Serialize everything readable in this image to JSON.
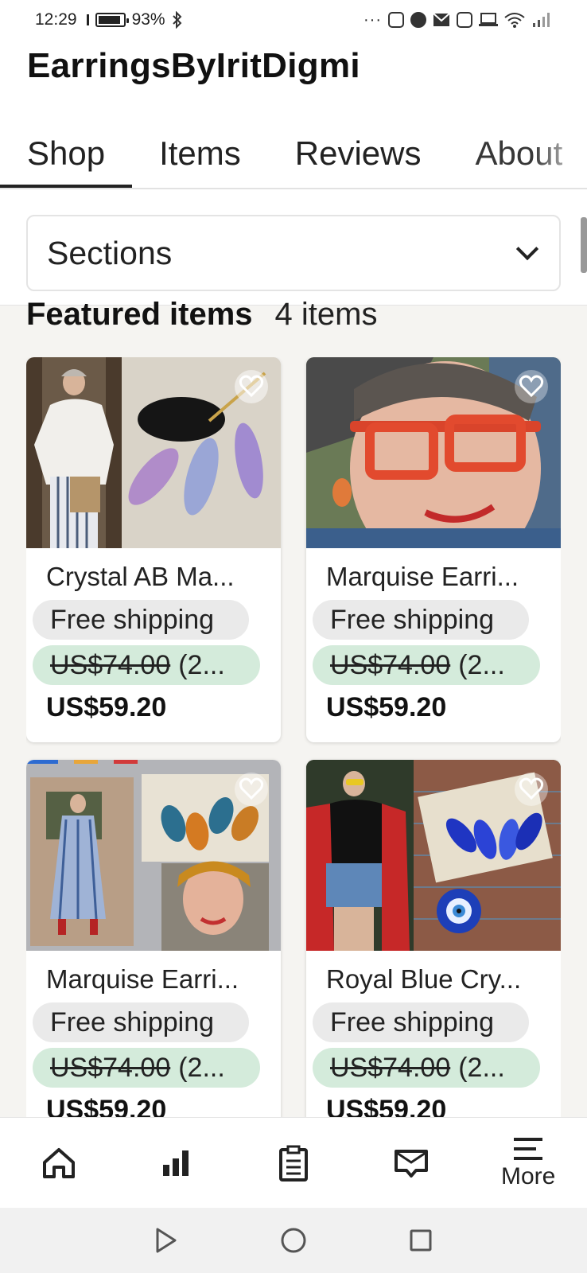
{
  "status_bar": {
    "time": "12:29",
    "battery_percent": "93%",
    "battery_level": 0.93,
    "icons": [
      "bluetooth-icon",
      "more-dots-icon",
      "instagram-icon",
      "facebook-icon",
      "gmail-icon",
      "instagram-icon",
      "laptop-icon",
      "wifi-icon",
      "signal-icon"
    ]
  },
  "header": {
    "shop_name": "EarringsByIritDigmi",
    "tabs": [
      "Shop",
      "Items",
      "Reviews",
      "About"
    ],
    "active_tab": "Shop"
  },
  "sections": {
    "label": "Sections"
  },
  "featured": {
    "title": "Featured items",
    "count": "4 items"
  },
  "listings": [
    {
      "title": "Crystal AB Ma...",
      "shipping": "Free shipping",
      "original_price": "US$74.00",
      "discount": "(2...",
      "sale_price": "US$59.20"
    },
    {
      "title": "Marquise Earri...",
      "shipping": "Free shipping",
      "original_price": "US$74.00",
      "discount": "(2...",
      "sale_price": "US$59.20"
    },
    {
      "title": "Marquise Earri...",
      "shipping": "Free shipping",
      "original_price": "US$74.00",
      "discount": "(2...",
      "sale_price": "US$59.20"
    },
    {
      "title": "Royal Blue Cry...",
      "shipping": "Free shipping",
      "original_price": "US$74.00",
      "discount": "(2...",
      "sale_price": "US$59.20"
    }
  ],
  "bottom_nav": {
    "items": [
      "home-icon",
      "stats-icon",
      "orders-icon",
      "messages-icon",
      "menu-icon"
    ],
    "more_label": "More"
  },
  "system_nav": [
    "back-icon",
    "home-circle-icon",
    "recents-icon"
  ],
  "colors": {
    "background": "#f5f4f1",
    "price_pill": "#d4ebdb",
    "shipping_pill": "#eaeaea",
    "text": "#222222"
  }
}
